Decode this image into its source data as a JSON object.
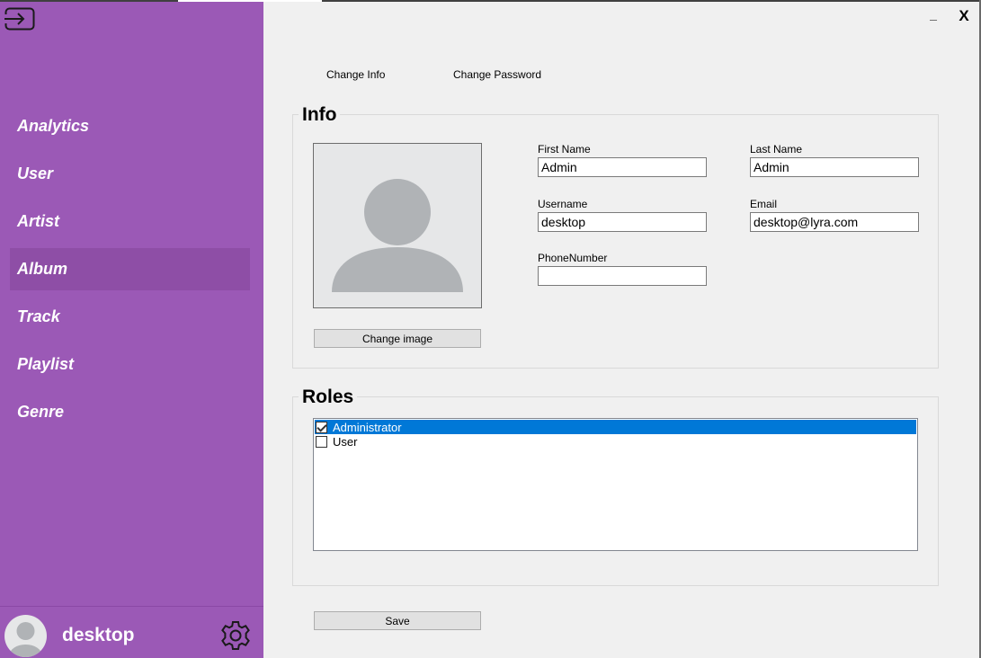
{
  "window": {
    "minimize_label": "_",
    "close_label": "X"
  },
  "sidebar": {
    "logout_icon": "logout-icon",
    "items": [
      {
        "label": "Analytics",
        "active": false
      },
      {
        "label": "User",
        "active": false
      },
      {
        "label": "Artist",
        "active": false
      },
      {
        "label": "Album",
        "active": true
      },
      {
        "label": "Track",
        "active": false
      },
      {
        "label": "Playlist",
        "active": false
      },
      {
        "label": "Genre",
        "active": false
      }
    ],
    "profile": {
      "name": "desktop",
      "avatar_icon": "user-avatar-icon",
      "settings_icon": "gear-icon"
    }
  },
  "tabs": [
    {
      "label": "Change Info"
    },
    {
      "label": "Change Password"
    }
  ],
  "info": {
    "title": "Info",
    "change_image_label": "Change image",
    "fields": {
      "first_name": {
        "label": "First Name",
        "value": "Admin"
      },
      "last_name": {
        "label": "Last Name",
        "value": "Admin"
      },
      "username": {
        "label": "Username",
        "value": "desktop"
      },
      "email": {
        "label": "Email",
        "value": "desktop@lyra.com"
      },
      "phone": {
        "label": "PhoneNumber",
        "value": ""
      }
    }
  },
  "roles": {
    "title": "Roles",
    "items": [
      {
        "label": "Administrator",
        "checked": true,
        "selected": true
      },
      {
        "label": "User",
        "checked": false,
        "selected": false
      }
    ]
  },
  "save_label": "Save",
  "colors": {
    "sidebar": "#9b59b6",
    "sidebar_active": "#8e4ea6",
    "selection": "#0078d7",
    "background": "#f0f0f0"
  }
}
